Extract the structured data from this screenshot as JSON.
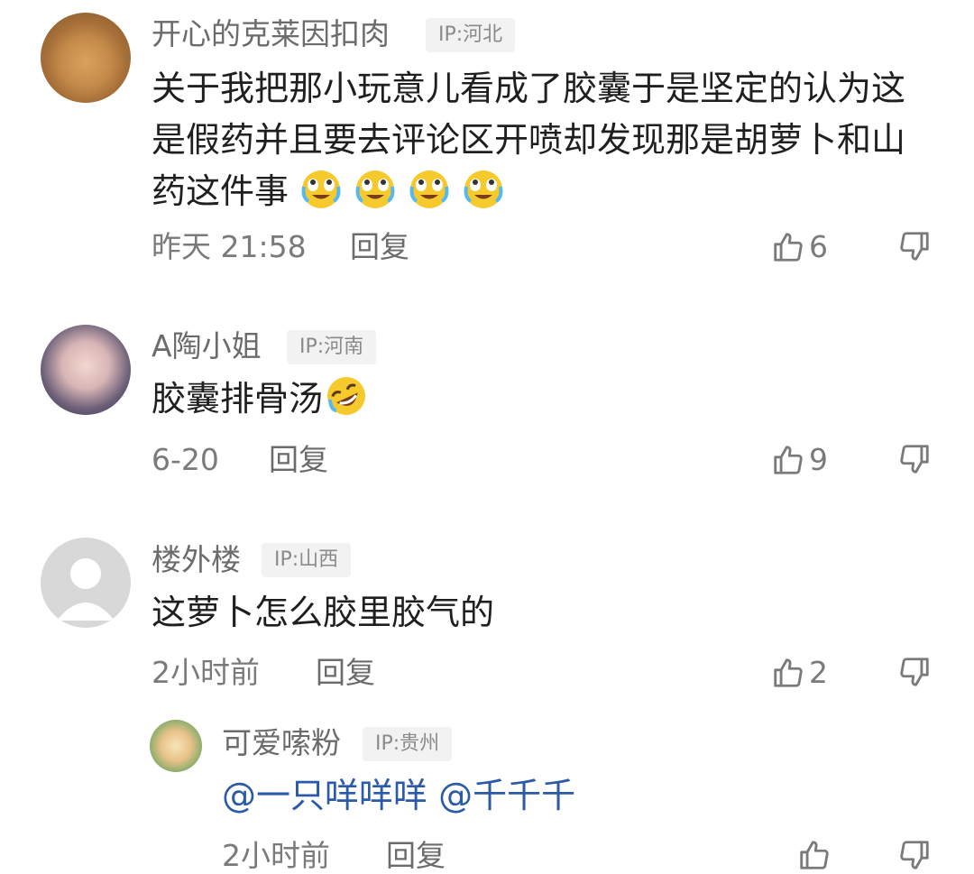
{
  "comments": [
    {
      "username": "开心的克莱因扣肉",
      "ip": "IP:河北",
      "content": "关于我把那小玩意儿看成了胶囊于是坚定的认为这是假药并且要去评论区开喷却发现那是胡萝卜和山药这件事",
      "time": "昨天 21:58",
      "reply": "回复",
      "likes": "6",
      "emoji": "crying-laughing-emoji"
    },
    {
      "username": "A陶小姐",
      "ip": "IP:河南",
      "content": "胶囊排骨汤",
      "time": "6-20",
      "reply": "回复",
      "likes": "9",
      "emoji": "rofl-emoji"
    },
    {
      "username": "楼外楼",
      "ip": "IP:山西",
      "content": "这萝卜怎么胶里胶气的",
      "time": "2小时前",
      "reply": "回复",
      "likes": "2"
    }
  ],
  "reply": {
    "username": "可爱嗦粉",
    "ip": "IP:贵州",
    "mention1": "@一只咩咩咩",
    "mention2": "@千千千",
    "time": "2小时前",
    "reply": "回复"
  }
}
